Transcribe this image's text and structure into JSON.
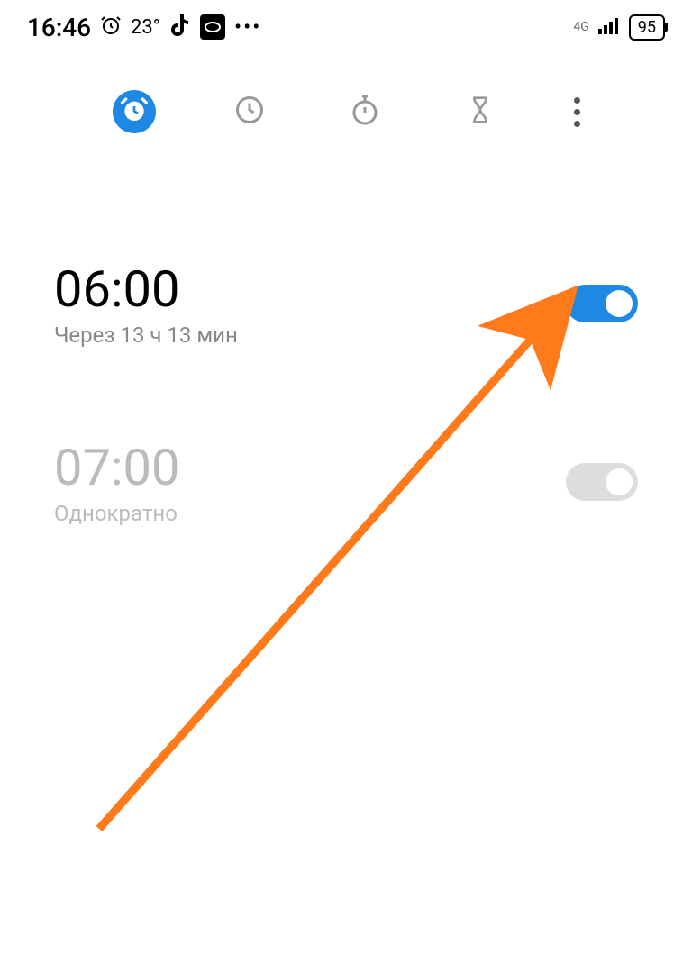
{
  "status_bar": {
    "time": "16:46",
    "temperature": "23°",
    "network_label": "4G",
    "battery": "95"
  },
  "tabs": {
    "alarm": "alarm",
    "clock": "clock",
    "stopwatch": "stopwatch",
    "timer": "timer"
  },
  "alarms": [
    {
      "time": "06:00",
      "subtitle": "Через 13 ч 13 мин",
      "enabled": true
    },
    {
      "time": "07:00",
      "subtitle": "Однократно",
      "enabled": false
    }
  ],
  "colors": {
    "accent": "#1e88e5",
    "annotation": "#ff7a1a"
  }
}
